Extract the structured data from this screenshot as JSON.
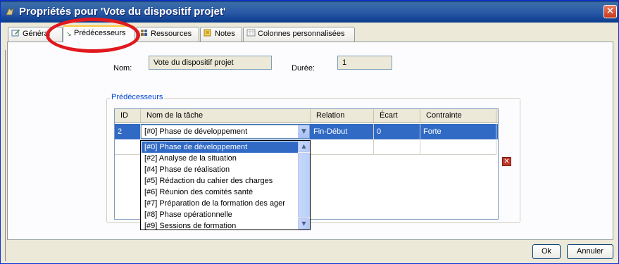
{
  "window": {
    "title": "Propriétés pour 'Vote du dispositif projet'",
    "close_label": "✕"
  },
  "tabs": [
    {
      "label": "Général",
      "icon": "edit-icon"
    },
    {
      "label": "Prédécesseurs",
      "icon": "predecessors-icon",
      "active": true
    },
    {
      "label": "Ressources",
      "icon": "resources-icon"
    },
    {
      "label": "Notes",
      "icon": "notes-icon"
    },
    {
      "label": "Colonnes personnalisées",
      "icon": "columns-icon"
    }
  ],
  "fields": {
    "name_label": "Nom:",
    "name_value": "Vote du dispositif projet",
    "duration_label": "Durée:",
    "duration_value": "1"
  },
  "predecessors": {
    "legend": "Prédécesseurs",
    "columns": [
      "ID",
      "Nom de la tâche",
      "Relation",
      "Écart",
      "Contrainte"
    ],
    "rows": [
      {
        "id": "2",
        "task": "[#0] Phase de développement",
        "relation": "Fin-Début",
        "gap": "0",
        "constraint": "Forte"
      }
    ],
    "dropdown_options": [
      "[#0] Phase de développement",
      "[#2] Analyse de la situation",
      "[#4] Phase de réalisation",
      "[#5] Rédaction du cahier des charges",
      "[#6] Réunion des comités santé",
      "[#7] Préparation de la formation des ager",
      "[#8] Phase opérationnelle",
      "[#9] Sessions de formation"
    ]
  },
  "buttons": {
    "ok": "Ok",
    "cancel": "Annuler"
  },
  "colors": {
    "selection": "#316ac5",
    "titlebar": "#2C5BA8",
    "annotation_ring": "#e0191e"
  }
}
